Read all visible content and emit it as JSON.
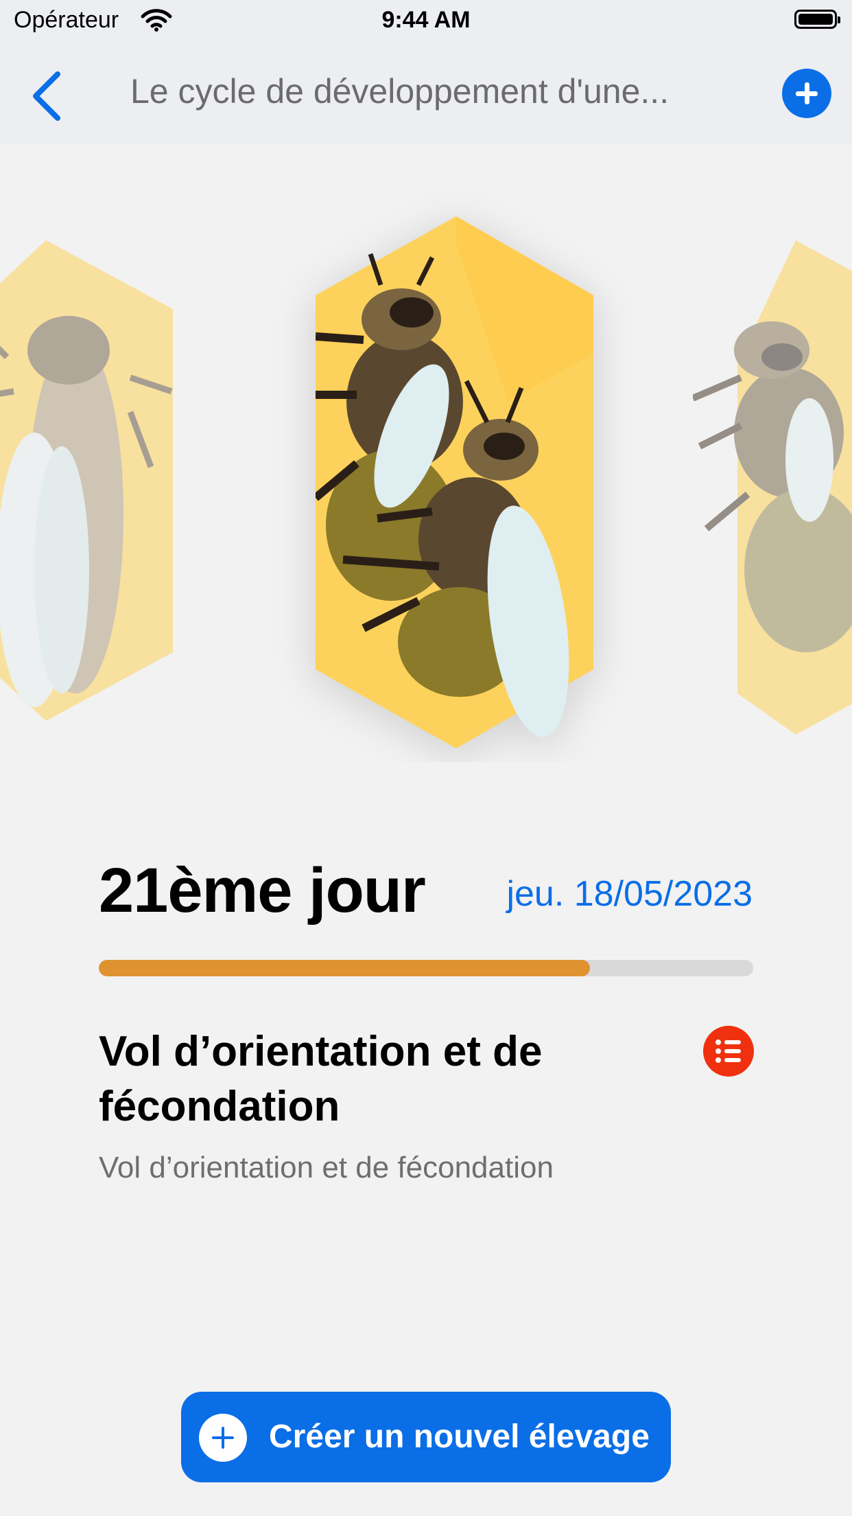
{
  "status_bar": {
    "carrier": "Opérateur",
    "time": "9:44 AM"
  },
  "nav": {
    "title": "Le cycle de développement d'une..."
  },
  "day": {
    "title": "21ème jour",
    "date": "jeu. 18/05/2023",
    "progress": 0.75
  },
  "stage": {
    "title": "Vol d’orientation et de fécondation",
    "subtitle": "Vol d’orientation et de fécondation"
  },
  "create_button": {
    "label": "Créer un nouvel élevage"
  },
  "colors": {
    "accent": "#0a6ee6",
    "progress": "#df9230",
    "list_button": "#f0310f",
    "honeycomb": "#fdd25c"
  },
  "icons": [
    "back-chevron-icon",
    "plus-circle-icon",
    "list-icon",
    "plus-icon",
    "wifi-icon",
    "battery-icon"
  ]
}
